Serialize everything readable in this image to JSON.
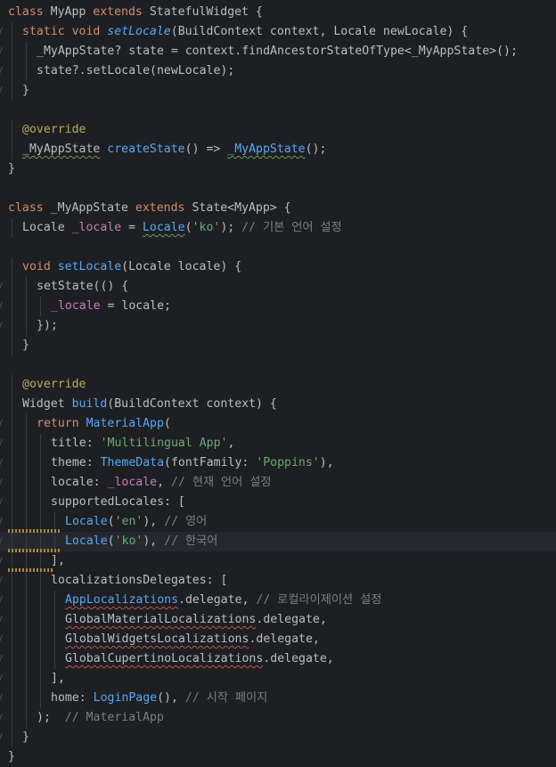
{
  "editor": {
    "lines": [
      {
        "indent": 0,
        "tokens": [
          [
            "kw",
            "class "
          ],
          [
            "",
            "MyApp "
          ],
          [
            "kw",
            "extends "
          ],
          [
            "",
            "StatefulWidget {"
          ]
        ]
      },
      {
        "indent": 1,
        "tokens": [
          [
            "kw",
            "static void "
          ],
          [
            "fni",
            "setLocale"
          ],
          [
            "",
            "(BuildContext context, Locale newLocale) {"
          ]
        ]
      },
      {
        "indent": 2,
        "tokens": [
          [
            "",
            "_MyAppState? state = context.findAncestorStateOfType<_MyAppState>();"
          ]
        ]
      },
      {
        "indent": 2,
        "tokens": [
          [
            "",
            "state?.setLocale(newLocale);"
          ]
        ]
      },
      {
        "indent": 1,
        "tokens": [
          [
            "",
            "}"
          ]
        ]
      },
      {
        "indent": 0,
        "tokens": []
      },
      {
        "indent": 1,
        "tokens": [
          [
            "ann",
            "@override"
          ]
        ]
      },
      {
        "indent": 1,
        "tokens": [
          [
            "typo",
            "_MyAppState"
          ],
          [
            "",
            ""
          ],
          [
            "fn",
            " createState"
          ],
          [
            "",
            "() => "
          ],
          [
            "fn typo",
            "_MyAppState"
          ],
          [
            "",
            "();"
          ]
        ]
      },
      {
        "indent": 0,
        "tokens": [
          [
            "",
            "}"
          ]
        ]
      },
      {
        "indent": 0,
        "tokens": []
      },
      {
        "indent": 0,
        "tokens": [
          [
            "kw",
            "class "
          ],
          [
            "",
            "_MyAppState "
          ],
          [
            "kw",
            "extends "
          ],
          [
            "",
            "State<MyApp> {"
          ]
        ]
      },
      {
        "indent": 1,
        "tokens": [
          [
            "",
            "Locale "
          ],
          [
            "fld",
            "_locale"
          ],
          [
            "",
            " = "
          ],
          [
            "fn typo",
            "Locale"
          ],
          [
            "",
            "("
          ],
          [
            "str",
            "'ko'"
          ],
          [
            "",
            "); "
          ],
          [
            "cmt",
            "// 기본 언어 설정"
          ]
        ]
      },
      {
        "indent": 0,
        "tokens": []
      },
      {
        "indent": 1,
        "tokens": [
          [
            "kw",
            "void "
          ],
          [
            "fn",
            "setLocale"
          ],
          [
            "",
            "(Locale locale) {"
          ]
        ]
      },
      {
        "indent": 2,
        "tokens": [
          [
            "",
            "setState(() {"
          ]
        ]
      },
      {
        "indent": 3,
        "tokens": [
          [
            "fld",
            "_locale"
          ],
          [
            "",
            " = locale;"
          ]
        ]
      },
      {
        "indent": 2,
        "tokens": [
          [
            "",
            "});"
          ]
        ]
      },
      {
        "indent": 1,
        "tokens": [
          [
            "",
            "}"
          ]
        ]
      },
      {
        "indent": 0,
        "tokens": []
      },
      {
        "indent": 1,
        "tokens": [
          [
            "ann",
            "@override"
          ]
        ]
      },
      {
        "indent": 1,
        "tokens": [
          [
            "",
            "Widget "
          ],
          [
            "fn",
            "build"
          ],
          [
            "",
            "(BuildContext context) {"
          ]
        ]
      },
      {
        "indent": 2,
        "tokens": [
          [
            "kw",
            "return "
          ],
          [
            "fn",
            "MaterialApp"
          ],
          [
            "",
            "("
          ]
        ]
      },
      {
        "indent": 3,
        "tokens": [
          [
            "",
            "title: "
          ],
          [
            "str",
            "'Multilingual App'"
          ],
          [
            "",
            ","
          ]
        ]
      },
      {
        "indent": 3,
        "tokens": [
          [
            "",
            "theme: "
          ],
          [
            "fn",
            "ThemeData"
          ],
          [
            "",
            "(fontFamily: "
          ],
          [
            "str",
            "'Poppins'"
          ],
          [
            "",
            "),"
          ]
        ]
      },
      {
        "indent": 3,
        "tokens": [
          [
            "",
            "locale: "
          ],
          [
            "fld",
            "_locale"
          ],
          [
            "",
            ", "
          ],
          [
            "cmt",
            "// 현재 언어 설정"
          ]
        ]
      },
      {
        "indent": 3,
        "tokens": [
          [
            "",
            "supportedLocales: ["
          ]
        ]
      },
      {
        "indent": 4,
        "tokens": [
          [
            "fn",
            "Locale"
          ],
          [
            "",
            "("
          ],
          [
            "str",
            "'en'"
          ],
          [
            "",
            "), "
          ],
          [
            "cmt",
            "// 영어"
          ]
        ]
      },
      {
        "indent": 4,
        "tokens": [
          [
            "fn",
            "Locale"
          ],
          [
            "",
            "("
          ],
          [
            "str",
            "'ko'"
          ],
          [
            "",
            "), "
          ],
          [
            "cmt",
            "// 한국어"
          ]
        ]
      },
      {
        "indent": 3,
        "tokens": [
          [
            "",
            "],"
          ]
        ]
      },
      {
        "indent": 3,
        "tokens": [
          [
            "",
            "localizationsDelegates: ["
          ]
        ]
      },
      {
        "indent": 4,
        "tokens": [
          [
            "fn err",
            "AppLocalizations"
          ],
          [
            "",
            ".delegate, "
          ],
          [
            "cmt",
            "// 로컬라이제이션 설정"
          ]
        ]
      },
      {
        "indent": 4,
        "tokens": [
          [
            "err",
            "GlobalMaterialLocalizations"
          ],
          [
            "",
            ".delegate,"
          ]
        ]
      },
      {
        "indent": 4,
        "tokens": [
          [
            "err",
            "GlobalWidgetsLocalizations"
          ],
          [
            "",
            ".delegate,"
          ]
        ]
      },
      {
        "indent": 4,
        "tokens": [
          [
            "err",
            "GlobalCupertinoLocalizations"
          ],
          [
            "",
            ".delegate,"
          ]
        ]
      },
      {
        "indent": 3,
        "tokens": [
          [
            "",
            "],"
          ]
        ]
      },
      {
        "indent": 3,
        "tokens": [
          [
            "",
            "home: "
          ],
          [
            "fn",
            "LoginPage"
          ],
          [
            "",
            "(), "
          ],
          [
            "cmt",
            "// 시작 페이지"
          ]
        ]
      },
      {
        "indent": 2,
        "tokens": [
          [
            "",
            ");  "
          ],
          [
            "cmt",
            "// MaterialApp"
          ]
        ]
      },
      {
        "indent": 1,
        "tokens": [
          [
            "",
            "}"
          ]
        ]
      },
      {
        "indent": 0,
        "tokens": [
          [
            "",
            "}"
          ]
        ]
      }
    ]
  }
}
